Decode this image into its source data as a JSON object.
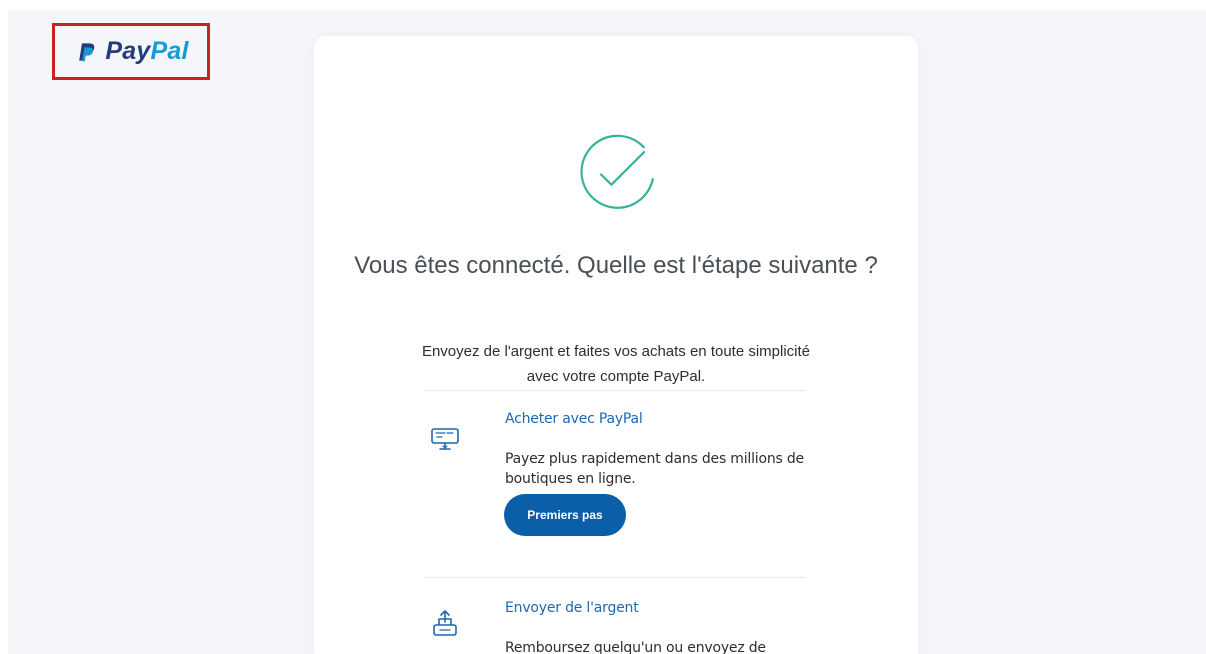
{
  "brand": {
    "pay": "Pay",
    "pal": "Pal",
    "highlight_color": "#c8212a",
    "primary_color": "#253b80",
    "secondary_color": "#179bd7"
  },
  "confirmation": {
    "heading": "Vous êtes connecté. Quelle est l'étape suivante ?",
    "subheading": "Envoyez de l'argent et faites vos achats en toute simplicité avec votre compte PayPal."
  },
  "features": [
    {
      "title": "Acheter avec PayPal",
      "description": "Payez plus rapidement dans des millions de boutiques en ligne.",
      "button_label": "Premiers pas",
      "icon": "shopping-screen-icon"
    },
    {
      "title": "Envoyer de l'argent",
      "description": "Remboursez quelqu'un ou envoyez de l'argent à vos proches.",
      "icon": "send-money-icon"
    }
  ],
  "colors": {
    "background": "#f4f6f9",
    "card": "#ffffff",
    "success": "#37b39a",
    "link": "#1f67b2",
    "button": "#0b5ea8"
  }
}
